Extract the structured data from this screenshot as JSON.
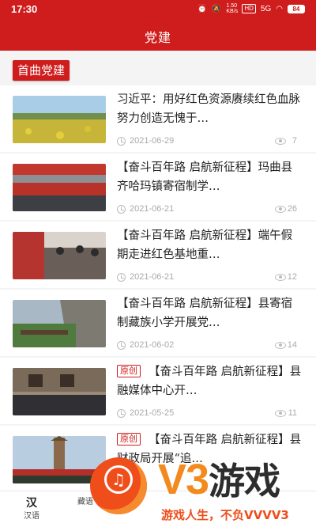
{
  "status_bar": {
    "time": "17:30",
    "network_speed": "1.50 KB/s",
    "hd_badge": "HD",
    "signal": "5G",
    "battery": "84"
  },
  "header": {
    "title": "党建"
  },
  "section": {
    "tag": "首曲党建"
  },
  "news": [
    {
      "title": "习近平：用好红色资源赓续红色血脉 努力创造无愧于…",
      "original": "",
      "date": "2021-06-29",
      "views": "7",
      "thumb": "field"
    },
    {
      "title": "【奋斗百年路 启航新征程】玛曲县齐哈玛镇寄宿制学…",
      "original": "",
      "date": "2021-06-21",
      "views": "26",
      "thumb": "crowd"
    },
    {
      "title": "【奋斗百年路 启航新征程】端午假期走进红色基地重…",
      "original": "",
      "date": "2021-06-21",
      "views": "12",
      "thumb": "visit"
    },
    {
      "title": "【奋斗百年路 启航新征程】县寄宿制藏族小学开展党…",
      "original": "",
      "date": "2021-06-02",
      "views": "14",
      "thumb": "cliff"
    },
    {
      "title": "【奋斗百年路 启航新征程】县融媒体中心开…",
      "original": "原创",
      "date": "2021-05-25",
      "views": "11",
      "thumb": "cave"
    },
    {
      "title": "【奋斗百年路 启航新征程】县财政局开展“追…",
      "original": "原创",
      "date": "",
      "views": "",
      "thumb": "tower"
    }
  ],
  "bottom_nav": [
    {
      "icon": "汉",
      "label": "汉语"
    },
    {
      "icon": "",
      "label": "藏语"
    }
  ],
  "watermark": {
    "brand": "V3",
    "brand_cn": "游戏",
    "slogan": "游戏人生，不负VVVV3"
  },
  "colors": {
    "primary": "#cf1c1c",
    "accent": "#f28a1e"
  }
}
